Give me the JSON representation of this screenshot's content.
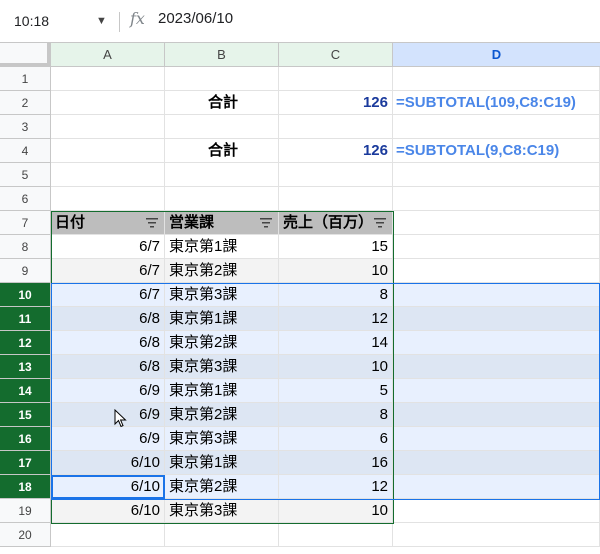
{
  "formula_bar": {
    "cell_ref": "10:18",
    "fx_label": "fx",
    "formula": "2023/06/10"
  },
  "columns": [
    "A",
    "B",
    "C",
    "D"
  ],
  "rows": [
    "1",
    "2",
    "3",
    "4",
    "5",
    "6",
    "7",
    "8",
    "9",
    "10",
    "11",
    "12",
    "13",
    "14",
    "15",
    "16",
    "17",
    "18",
    "19",
    "20"
  ],
  "summary": [
    {
      "label": "合計",
      "value": "126",
      "note": "=SUBTOTAL(109,C8:C19)"
    },
    {
      "label": "合計",
      "value": "126",
      "note": "=SUBTOTAL(9,C8:C19)"
    }
  ],
  "table": {
    "headers": [
      "日付",
      "営業課",
      "売上（百万）"
    ],
    "rows": [
      [
        "6/7",
        "東京第1課",
        "15"
      ],
      [
        "6/7",
        "東京第2課",
        "10"
      ],
      [
        "6/7",
        "東京第3課",
        "8"
      ],
      [
        "6/8",
        "東京第1課",
        "12"
      ],
      [
        "6/8",
        "東京第2課",
        "14"
      ],
      [
        "6/8",
        "東京第3課",
        "10"
      ],
      [
        "6/9",
        "東京第1課",
        "5"
      ],
      [
        "6/9",
        "東京第2課",
        "8"
      ],
      [
        "6/9",
        "東京第3課",
        "6"
      ],
      [
        "6/10",
        "東京第1課",
        "16"
      ],
      [
        "6/10",
        "東京第2課",
        "12"
      ],
      [
        "6/10",
        "東京第3課",
        "10"
      ]
    ]
  },
  "colors": {
    "selected_row_header": "#146c2e",
    "table_header_bg": "#bdbdbd",
    "selection_fill": "#e8f0fe",
    "formula_note": "#4a86e8",
    "sum_value": "#1a3a9c"
  }
}
